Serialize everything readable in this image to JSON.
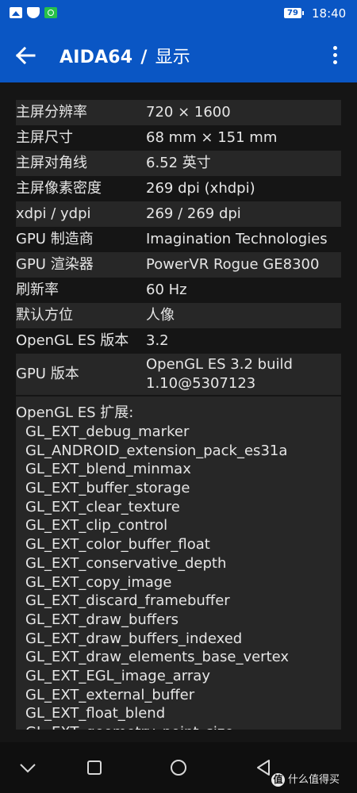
{
  "status_bar": {
    "battery": "79",
    "time": "18:40",
    "icons": [
      "image-icon",
      "shield-icon",
      "camera-icon"
    ]
  },
  "app_bar": {
    "app_name": "AIDA64",
    "separator": "/",
    "section": "显示",
    "back_icon": "arrow-left-icon",
    "menu_icon": "more-vert-icon"
  },
  "rows": [
    {
      "label": "主屏分辨率",
      "value": "720 × 1600"
    },
    {
      "label": "主屏尺寸",
      "value": "68 mm × 151 mm"
    },
    {
      "label": "主屏对角线",
      "value": "6.52 英寸"
    },
    {
      "label": "主屏像素密度",
      "value": "269 dpi (xhdpi)"
    },
    {
      "label": "xdpi / ydpi",
      "value": "269 / 269 dpi"
    },
    {
      "label": "GPU 制造商",
      "value": "Imagination Technologies"
    },
    {
      "label": "GPU 渲染器",
      "value": "PowerVR Rogue GE8300"
    },
    {
      "label": "刷新率",
      "value": "60 Hz"
    },
    {
      "label": "默认方位",
      "value": "人像"
    },
    {
      "label": "OpenGL ES 版本",
      "value": "3.2"
    },
    {
      "label": "GPU 版本",
      "value_line1": "OpenGL ES 3.2 build",
      "value_line2": "1.10@5307123"
    }
  ],
  "extensions": {
    "title": "OpenGL ES 扩展:",
    "items": [
      "GL_EXT_debug_marker",
      "GL_ANDROID_extension_pack_es31a",
      "GL_EXT_blend_minmax",
      "GL_EXT_buffer_storage",
      "GL_EXT_clear_texture",
      "GL_EXT_clip_control",
      "GL_EXT_color_buffer_float",
      "GL_EXT_conservative_depth",
      "GL_EXT_copy_image",
      "GL_EXT_discard_framebuffer",
      "GL_EXT_draw_buffers",
      "GL_EXT_draw_buffers_indexed",
      "GL_EXT_draw_elements_base_vertex",
      "GL_EXT_EGL_image_array",
      "GL_EXT_external_buffer",
      "GL_EXT_float_blend",
      "GL_EXT_geometry_point_size"
    ]
  },
  "nav_bar": {
    "icons": [
      "chevron-down-icon",
      "square-icon",
      "circle-home-icon",
      "triangle-back-icon"
    ],
    "watermark_logo": "值",
    "watermark_text": "什么值得买"
  },
  "colors": {
    "accent": "#0a56c4",
    "background": "#151515",
    "row_alt": "#272727",
    "text": "#e6e6e6"
  }
}
